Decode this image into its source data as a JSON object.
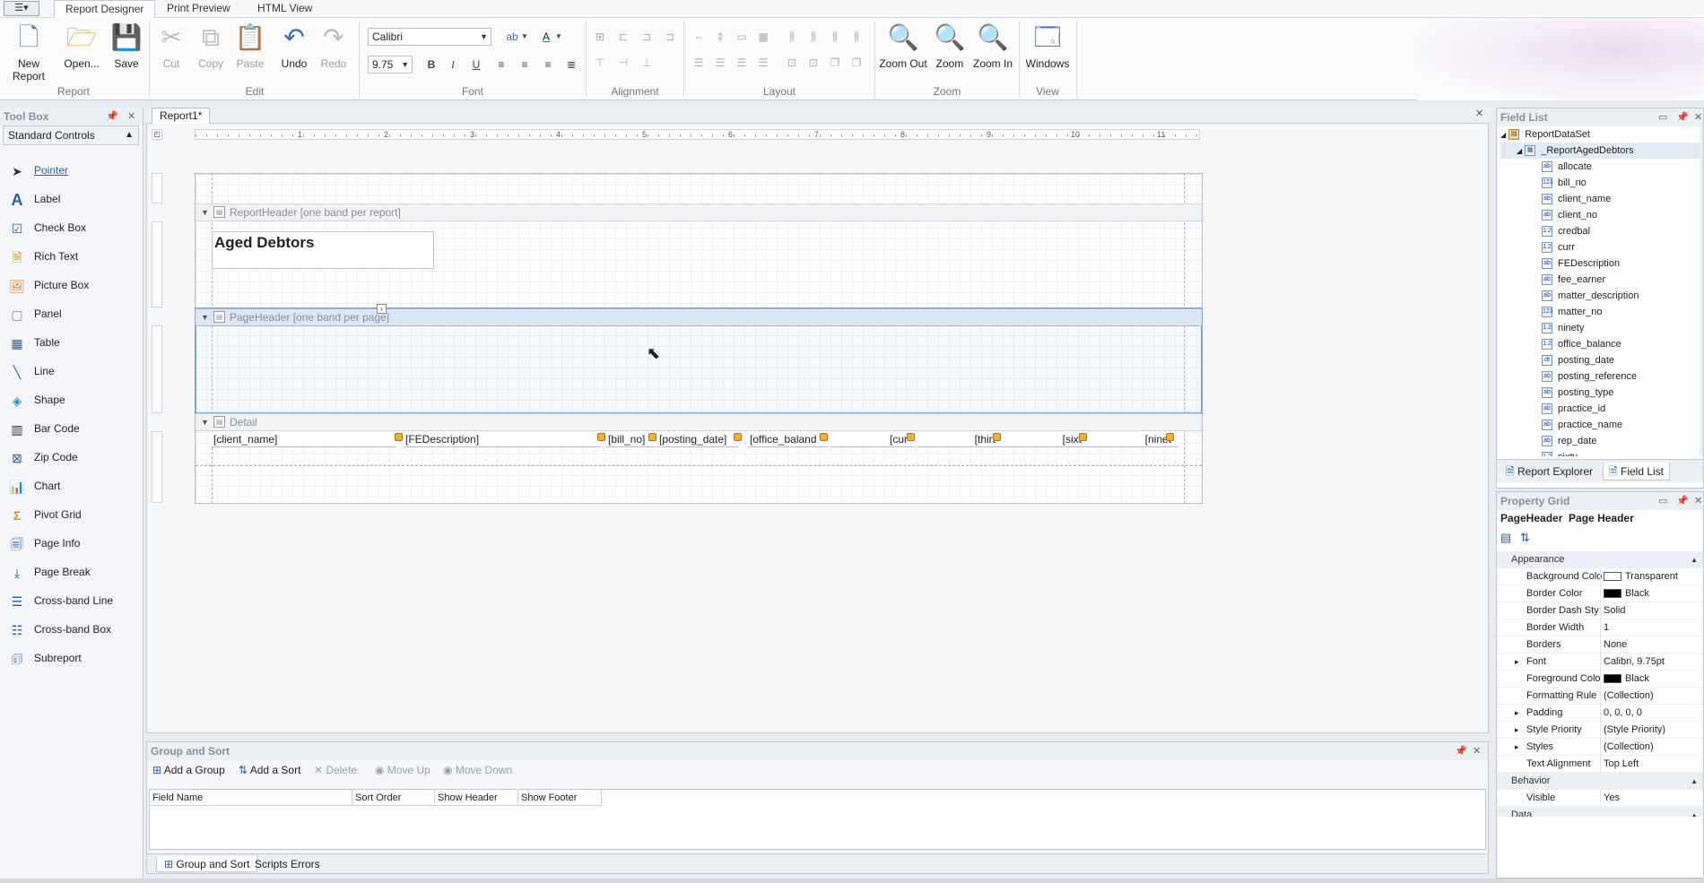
{
  "ribbon_tabs": [
    "Report Designer",
    "Print Preview",
    "HTML View"
  ],
  "ribbon": {
    "report": {
      "label": "Report",
      "new_report": "New Report",
      "open": "Open...",
      "save": "Save"
    },
    "edit": {
      "label": "Edit",
      "cut": "Cut",
      "copy": "Copy",
      "paste": "Paste",
      "undo": "Undo",
      "redo": "Redo"
    },
    "font": {
      "label": "Font",
      "family": "Calibri",
      "size": "9.75",
      "bold": "B",
      "italic": "I",
      "underline": "U"
    },
    "alignment": {
      "label": "Alignment"
    },
    "layout": {
      "label": "Layout"
    },
    "zoom": {
      "label": "Zoom",
      "zoom_out": "Zoom Out",
      "zoom": "Zoom",
      "zoom_in": "Zoom In"
    },
    "view": {
      "label": "View",
      "windows": "Windows"
    }
  },
  "toolbox": {
    "title": "Tool Box",
    "category": "Standard Controls",
    "items": [
      "Pointer",
      "Label",
      "Check Box",
      "Rich Text",
      "Picture Box",
      "Panel",
      "Table",
      "Line",
      "Shape",
      "Bar Code",
      "Zip Code",
      "Chart",
      "Pivot Grid",
      "Page Info",
      "Page Break",
      "Cross-band Line",
      "Cross-band Box",
      "Subreport"
    ]
  },
  "designer": {
    "doc_tab": "Report1*",
    "ruler_numbers": [
      "1",
      "2",
      "3",
      "4",
      "5",
      "6",
      "7",
      "8",
      "9",
      "10",
      "11"
    ],
    "bands": {
      "report_header": "ReportHeader [one band per report]",
      "page_header": "PageHeader [one band per page]",
      "detail": "Detail"
    },
    "title_label": "Aged Debtors",
    "detail_fields": [
      "[client_name]",
      "[FEDescription]",
      "[bill_no]",
      "[posting_date]",
      "[office_baland",
      "[cur",
      "[thirt",
      "[sixt",
      "[ninet"
    ]
  },
  "group_sort": {
    "title": "Group and Sort",
    "toolbar": {
      "add_group": "Add a Group",
      "add_sort": "Add a Sort",
      "delete": "Delete",
      "move_up": "Move Up",
      "move_down": "Move Down"
    },
    "columns": [
      "Field Name",
      "Sort Order",
      "Show Header",
      "Show Footer"
    ],
    "tabs": [
      "Group and Sort",
      "Scripts Errors"
    ]
  },
  "field_list": {
    "title": "Field List",
    "dataset": "ReportDataSet",
    "table": "_ReportAgedDebtors",
    "fields": [
      {
        "name": "allocate",
        "type": "ab"
      },
      {
        "name": "bill_no",
        "type": "123"
      },
      {
        "name": "client_name",
        "type": "ab"
      },
      {
        "name": "client_no",
        "type": "ab"
      },
      {
        "name": "credbal",
        "type": "1.2"
      },
      {
        "name": "curr",
        "type": "1.2"
      },
      {
        "name": "FEDescription",
        "type": "ab"
      },
      {
        "name": "fee_earner",
        "type": "ab"
      },
      {
        "name": "matter_description",
        "type": "ab"
      },
      {
        "name": "matter_no",
        "type": "123"
      },
      {
        "name": "ninety",
        "type": "1.2"
      },
      {
        "name": "office_balance",
        "type": "1.2"
      },
      {
        "name": "posting_date",
        "type": "dt"
      },
      {
        "name": "posting_reference",
        "type": "ab"
      },
      {
        "name": "posting_type",
        "type": "ab"
      },
      {
        "name": "practice_id",
        "type": "ab"
      },
      {
        "name": "practice_name",
        "type": "ab"
      },
      {
        "name": "rep_date",
        "type": "ab"
      },
      {
        "name": "sixty",
        "type": "1.2"
      }
    ],
    "tabs": [
      "Report Explorer",
      "Field List"
    ]
  },
  "property_grid": {
    "title": "Property Grid",
    "object_name": "PageHeader",
    "object_type": "Page Header",
    "rows": [
      {
        "kind": "cat",
        "name": "Appearance"
      },
      {
        "kind": "prop",
        "name": "Background Colo",
        "value": "Transparent",
        "swatch": "#ffffff"
      },
      {
        "kind": "prop",
        "name": "Border Color",
        "value": "Black",
        "swatch": "#000000"
      },
      {
        "kind": "prop",
        "name": "Border Dash Sty",
        "value": "Solid"
      },
      {
        "kind": "prop",
        "name": "Border Width",
        "value": "1"
      },
      {
        "kind": "prop",
        "name": "Borders",
        "value": "None"
      },
      {
        "kind": "prop",
        "name": "Font",
        "value": "Calibri, 9.75pt",
        "expand": true
      },
      {
        "kind": "prop",
        "name": "Foreground Colo",
        "value": "Black",
        "swatch": "#000000"
      },
      {
        "kind": "prop",
        "name": "Formatting Rule",
        "value": "(Collection)"
      },
      {
        "kind": "prop",
        "name": "Padding",
        "value": "0, 0, 0, 0",
        "expand": true
      },
      {
        "kind": "prop",
        "name": "Style Priority",
        "value": "(Style Priority)",
        "expand": true
      },
      {
        "kind": "prop",
        "name": "Styles",
        "value": "(Collection)",
        "expand": true
      },
      {
        "kind": "prop",
        "name": "Text Alignment",
        "value": "Top Left"
      },
      {
        "kind": "cat",
        "name": "Behavior"
      },
      {
        "kind": "prop",
        "name": "Visible",
        "value": "Yes"
      },
      {
        "kind": "cat",
        "name": "Data"
      }
    ]
  }
}
